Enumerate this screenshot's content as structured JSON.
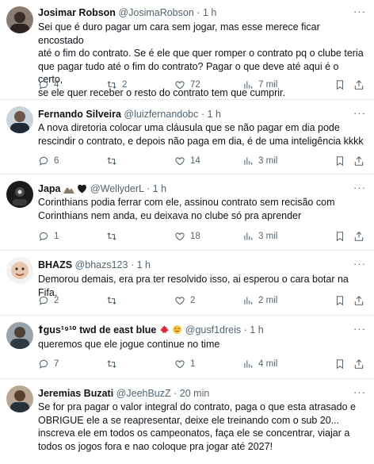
{
  "tweets": [
    {
      "name": "Josimar Robson",
      "handle": "@JosimaRobson",
      "time": "1 h",
      "text": "Sei que é duro pagar um cara sem jogar, mas esse merece ficar encostado\naté o fim do contrato. Se é ele que quer romper o contrato pq o clube teria\nque pagar tudo até o fim do contrato? Pagar o que deve até aqui é o certo,\nse ele quer receber o resto do contrato tem que cumprir.",
      "replies": "4",
      "retweets": "2",
      "likes": "72",
      "views": "7 mil"
    },
    {
      "name": "Fernando Silveira",
      "handle": "@luizfernandobc",
      "time": "1 h",
      "text": "A nova diretoria colocar uma cláusula que se não pagar em dia pode\nrescindir o contrato, e depois não paga em dia, é de uma inteligência kkkk",
      "replies": "6",
      "retweets": "",
      "likes": "14",
      "views": "3 mil"
    },
    {
      "name": "Japa",
      "handle": "@WellyderL",
      "time": "1 h",
      "text": "Corinthians podia ferrar com ele, assinou contrato sem recisão com\nCorinthians nem anda, eu deixava no clube só pra aprender",
      "replies": "1",
      "retweets": "",
      "likes": "18",
      "views": "3 mil"
    },
    {
      "name": "BHAZS",
      "handle": "@bhazs123",
      "time": "1 h",
      "text": "Demorou demais, era pra ter resolvido isso, ai esperou o cara botar na Fifa.",
      "replies": "2",
      "retweets": "",
      "likes": "2",
      "views": "2 mil"
    },
    {
      "name": "ꝉgus¹⁹¹⁰ twd de east blue",
      "handle": "@gusf1dreis",
      "time": "1 h",
      "text": "queremos que ele jogue continue no time",
      "replies": "7",
      "retweets": "",
      "likes": "1",
      "views": "4 mil"
    },
    {
      "name": "Jeremias Buzati",
      "handle": "@JeehBuzZ",
      "time": "20 min",
      "text": "Se for pra pagar o valor integral do contrato, paga o que esta atrasado e\nOBRIGUE ele a se reapresentar, deixe ele treinando com o sub 20...\ninscreva ele em todos os campeonatos, faça ele se concentrar, viajar a\ntodos os jogos fora e nao coloque pra jogar até 2027!",
      "replies": "",
      "retweets": "",
      "likes": "",
      "views": ""
    }
  ],
  "separator": "·",
  "more_glyph": "···",
  "icons": {
    "reply": "reply-icon",
    "retweet": "retweet-icon",
    "like": "heart-icon",
    "views": "views-icon",
    "bookmark": "bookmark-icon",
    "share": "share-icon"
  },
  "colors": {
    "text": "#0f1419",
    "secondary": "#536471",
    "divider": "#e6ebef"
  }
}
